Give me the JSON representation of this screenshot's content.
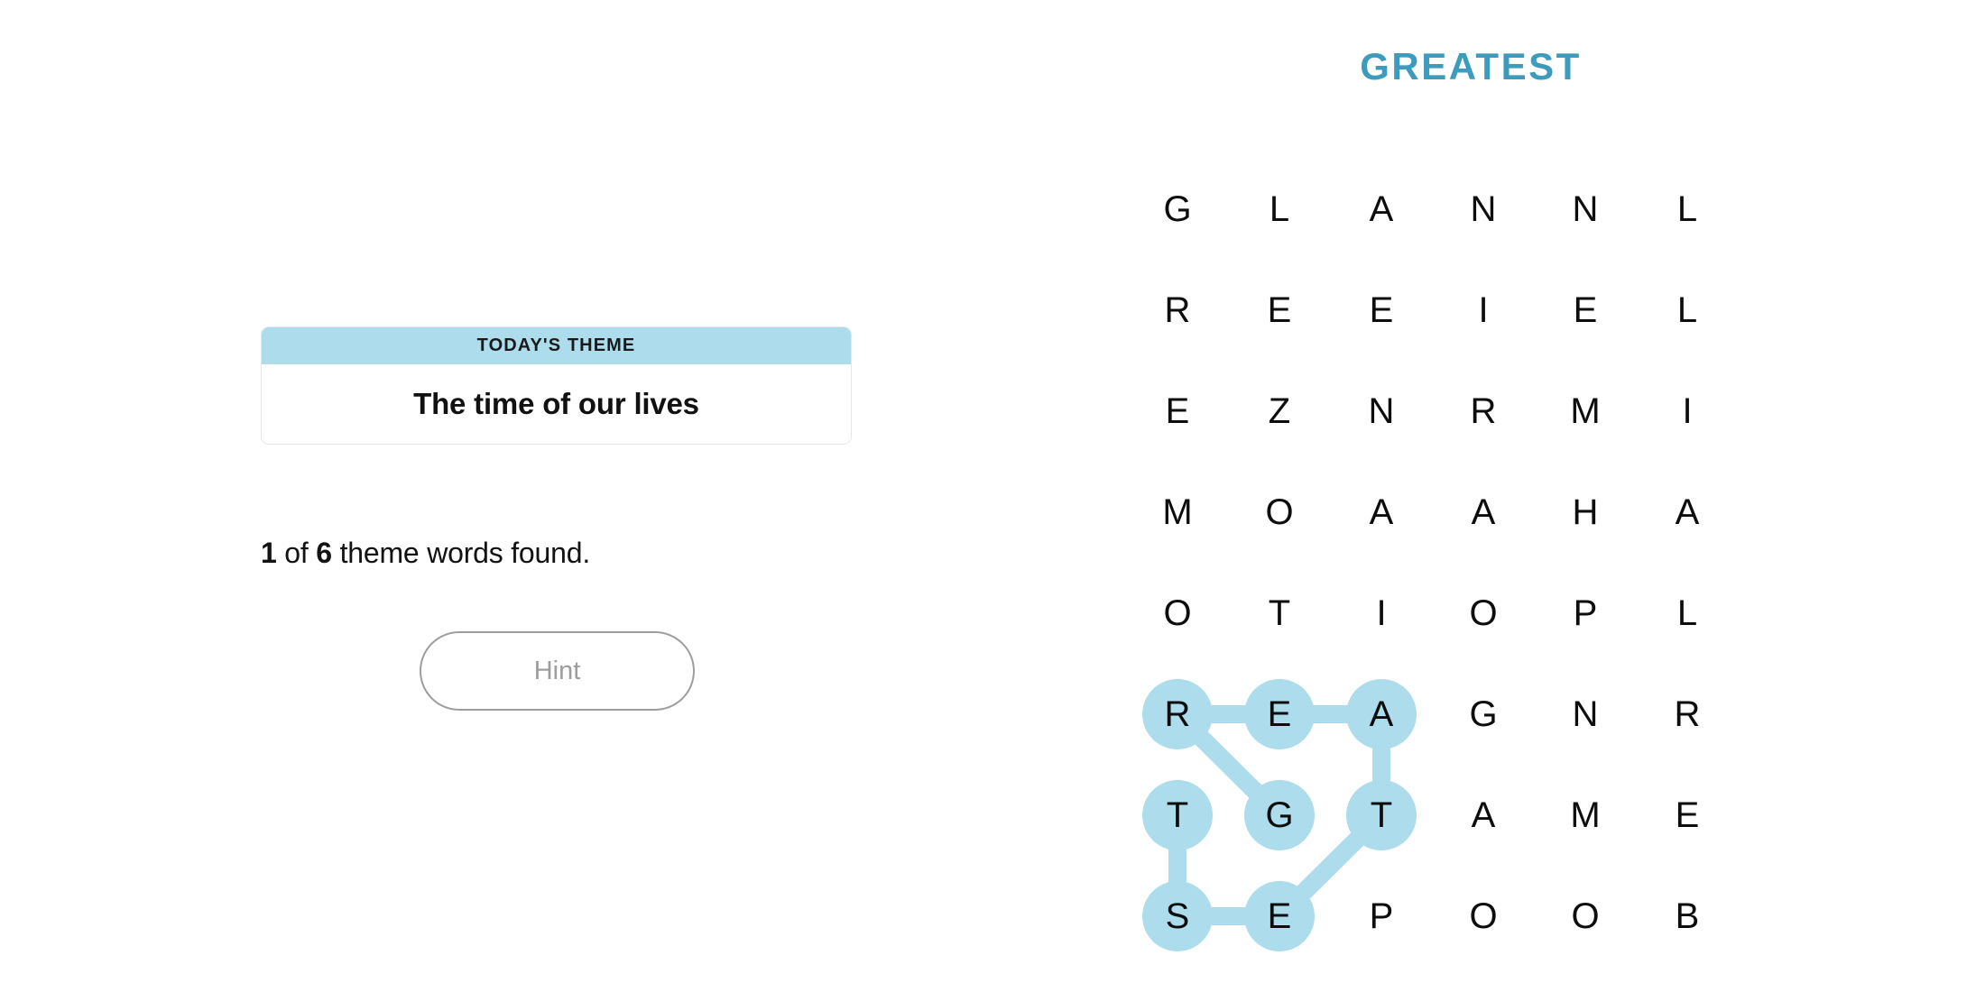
{
  "puzzle": {
    "title": "GREATEST",
    "title_color": "#3d9bbd",
    "highlight_color": "#addcec"
  },
  "theme_card": {
    "header_label": "TODAY'S THEME",
    "phrase": "The time of our lives"
  },
  "progress": {
    "found": "1",
    "middle_text": " of ",
    "total": "6",
    "suffix_text": " theme words found."
  },
  "hint_button": {
    "label": "Hint"
  },
  "grid": {
    "rows": 8,
    "cols": 6,
    "letters": [
      [
        "G",
        "L",
        "A",
        "N",
        "N",
        "L"
      ],
      [
        "R",
        "E",
        "E",
        "I",
        "E",
        "L"
      ],
      [
        "E",
        "Z",
        "N",
        "R",
        "M",
        "I"
      ],
      [
        "M",
        "O",
        "A",
        "A",
        "H",
        "A"
      ],
      [
        "O",
        "T",
        "I",
        "O",
        "P",
        "L"
      ],
      [
        "R",
        "E",
        "A",
        "G",
        "N",
        "R"
      ],
      [
        "T",
        "G",
        "T",
        "A",
        "M",
        "E"
      ],
      [
        "S",
        "E",
        "P",
        "O",
        "O",
        "B"
      ]
    ],
    "selected_cells": [
      [
        5,
        0
      ],
      [
        5,
        1
      ],
      [
        5,
        2
      ],
      [
        6,
        0
      ],
      [
        6,
        1
      ],
      [
        6,
        2
      ],
      [
        7,
        0
      ],
      [
        7,
        1
      ]
    ],
    "path_links": [
      [
        [
          5,
          0
        ],
        [
          5,
          1
        ]
      ],
      [
        [
          5,
          1
        ],
        [
          5,
          2
        ]
      ],
      [
        [
          5,
          0
        ],
        [
          6,
          1
        ]
      ],
      [
        [
          5,
          2
        ],
        [
          6,
          2
        ]
      ],
      [
        [
          6,
          2
        ],
        [
          7,
          1
        ]
      ],
      [
        [
          6,
          0
        ],
        [
          7,
          0
        ]
      ],
      [
        [
          7,
          0
        ],
        [
          7,
          1
        ]
      ]
    ]
  }
}
